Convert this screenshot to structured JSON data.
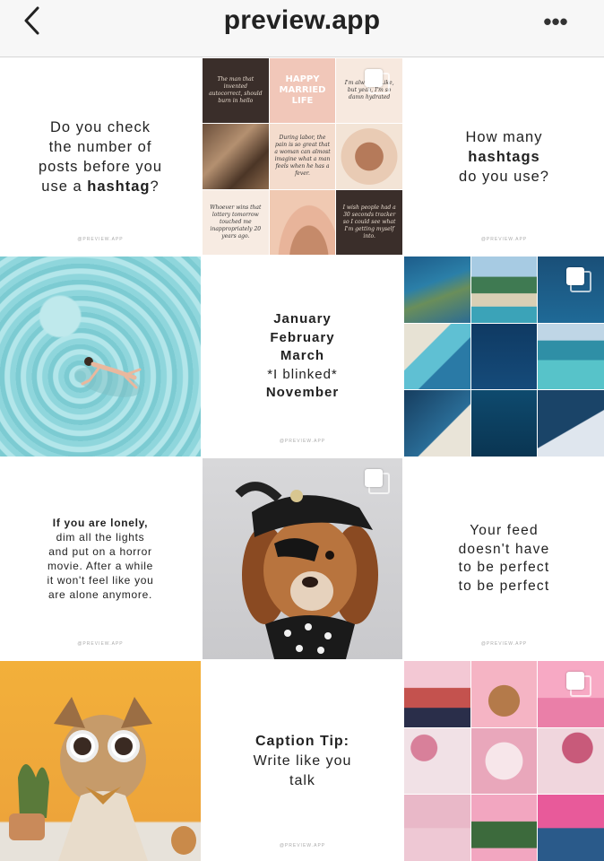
{
  "header": {
    "title": "preview.app",
    "back_icon": "chevron-left-icon",
    "more_icon": "more-horizontal-icon",
    "more_glyph": "•••"
  },
  "watermark": "@PREVIEW.APP",
  "tiles": {
    "hashtag_check": {
      "line1": "Do you check",
      "line2": "the number of",
      "line3": "posts before you",
      "line4_prefix": "use a ",
      "line4_bold": "hashtag",
      "line4_suffix": "?"
    },
    "hashtag_count": {
      "line1": "How many",
      "line2_bold": "hashtags",
      "line3": "do you use?"
    },
    "months": {
      "line1": "January",
      "line2": "February",
      "line3": "March",
      "line4": "*I blinked*",
      "line5": "November"
    },
    "lonely": {
      "line1_bold": "If you are lonely,",
      "line2": "dim all the lights",
      "line3": "and put on a horror",
      "line4": "movie. After a while",
      "line5": "it won't feel like you",
      "line6": "are alone anymore."
    },
    "feed": {
      "line1": "Your feed",
      "line2": "doesn't have",
      "line3": "to be perfect",
      "line4": "to be perfect"
    },
    "caption": {
      "line1_bold": "Caption Tip:",
      "line2": "Write like you",
      "line3": "talk"
    },
    "quotes_grid": {
      "q1": "The man that invented autocorrect, should burn in hello",
      "q2": "HAPPY MARRIED LIFE",
      "q3": "I'm always... Like, but yeah, I'm so damn hydrated",
      "q4": "During labor, the pain is so great that a woman can almost imagine what a man feels when he has a fever.",
      "q5": "Whoever wins that lottery tomorrow touched me inappropriately 20 years ago.",
      "q6": "I wish people had a 30 seconds tracker so I could see what I'm getting myself into."
    }
  }
}
